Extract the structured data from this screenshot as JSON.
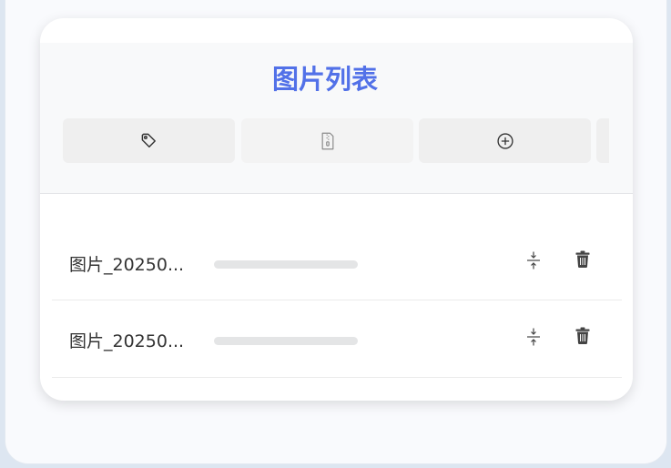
{
  "header": {
    "title": "图片列表"
  },
  "toolbar": {
    "buttons": [
      {
        "icon": "tag-icon"
      },
      {
        "icon": "zip-file-icon"
      },
      {
        "icon": "plus-circle-icon"
      },
      {
        "icon": "partially-hidden-button"
      }
    ]
  },
  "images": [
    {
      "name": "图片_20250...",
      "progress": 0
    },
    {
      "name": "图片_20250...",
      "progress": 0
    }
  ],
  "colors": {
    "accent": "#5271e8",
    "header_bg": "#f8f9fa",
    "button_bg": "#efefef",
    "progress_track": "#e4e5e6",
    "text": "#333333"
  }
}
